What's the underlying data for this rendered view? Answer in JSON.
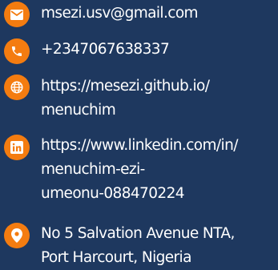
{
  "contacts": {
    "email": {
      "icon": "envelope-icon",
      "lines": [
        "msezi.usv@gmail.com"
      ]
    },
    "phone": {
      "icon": "phone-icon",
      "lines": [
        "+2347067638337"
      ]
    },
    "website": {
      "icon": "globe-icon",
      "lines": [
        "https://mesezi.github.io/",
        "menuchim"
      ]
    },
    "linkedin": {
      "icon": "linkedin-icon",
      "lines": [
        "https://www.linkedin.com/in/",
        "menuchim-ezi-",
        "umeonu-088470224"
      ]
    },
    "address": {
      "icon": "location-pin-icon",
      "lines": [
        "No 5 Salvation Avenue NTA,",
        "Port Harcourt, Nigeria"
      ]
    }
  },
  "colors": {
    "background": "#1e385f",
    "accent": "#f47c10",
    "text": "#ffffff"
  }
}
